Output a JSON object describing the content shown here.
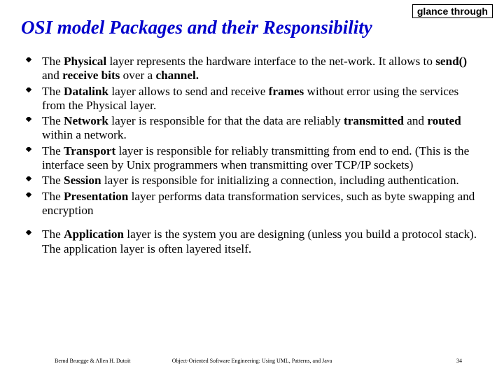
{
  "corner_tag": "glance through",
  "title": "OSI model Packages and their Responsibility",
  "bullets": [
    "The <b>Physical</b> layer represents the hardware interface to the net-work. It allows to <b>send()</b> and <b>receive bits</b> over a <b>channel.</b>",
    "The <b>Datalink</b> layer allows to send and receive <b>frames</b> without error using the services from the Physical layer.",
    "The <b>Network</b> layer is responsible for that the data are reliably <b>transmitted</b> and <b>routed</b> within a network.",
    "The <b>Transport</b> layer is responsible for reliably transmitting from end to end. (This is the interface seen by Unix programmers when transmitting over TCP/IP sockets)",
    "The <b>Session</b> layer is responsible for initializing a connection, including authentication.",
    "The <b>Presentation</b> layer performs data transformation services, such as byte swapping and encryption",
    "The <b>Application</b> layer is the system you are designing (unless you build a protocol stack). The application layer is often layered itself."
  ],
  "footer": {
    "left": "Bernd Bruegge & Allen H. Dutoit",
    "center": "Object-Oriented Software Engineering: Using UML, Patterns, and Java",
    "right": "34"
  }
}
